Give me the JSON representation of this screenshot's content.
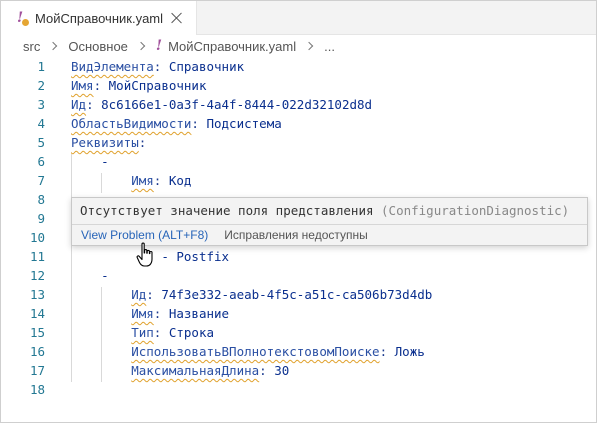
{
  "tab": {
    "label": "МойСправочник.yaml"
  },
  "breadcrumb": {
    "items": [
      "src",
      "Основное",
      "МойСправочник.yaml",
      "..."
    ]
  },
  "editor": {
    "line_numbers": [
      "1",
      "2",
      "3",
      "4",
      "5",
      "6",
      "7",
      "8",
      "9",
      "10",
      "11",
      "12",
      "13",
      "14",
      "15",
      "16",
      "17",
      "18"
    ],
    "lines": {
      "l1_key": "ВидЭлемента",
      "l1_val": "Справочник",
      "l2_key": "Имя",
      "l2_val": "МойСправочник",
      "l3_key": "Ид",
      "l3_val": "8c6166e1-0a3f-4a4f-8444-022d32102d8d",
      "l4_key": "ОбластьВидимости",
      "l4_val": "Подсистема",
      "l5_key": "Реквизиты",
      "l6_dash": "-",
      "l7_key": "Имя",
      "l7_val": "Код",
      "l11_text": "- Postfix",
      "l12_dash": "-",
      "l13_key": "Ид",
      "l13_val": "74f3e332-aeab-4f5c-a51c-ca506b73d4db",
      "l14_key": "Имя",
      "l14_val": "Название",
      "l15_key": "Тип",
      "l15_val": "Строка",
      "l16_key": "ИспользоватьВПолнотекстовомПоиске",
      "l16_val": "Ложь",
      "l17_key": "МаксимальнаяДлина",
      "l17_val": "30"
    }
  },
  "hover": {
    "message": "Отсутствует значение поля представления ",
    "source": "(ConfigurationDiagnostic)",
    "view_problem": "View Problem (ALT+F8)",
    "no_fixes": "Исправления недоступны"
  },
  "colors": {
    "accent": "#2764b8",
    "warning": "#e0a12c",
    "line_number": "#237893"
  }
}
